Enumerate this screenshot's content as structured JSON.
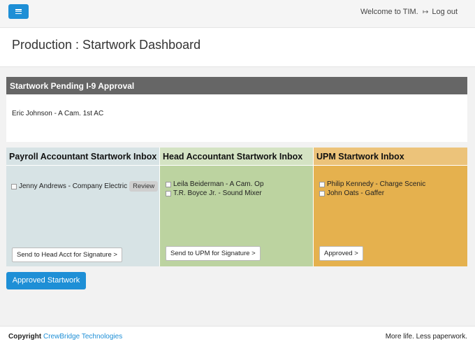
{
  "topbar": {
    "welcome": "Welcome to TIM.",
    "logout": "Log out",
    "menu_icon": "hamburger-icon",
    "logout_icon": "logout-icon"
  },
  "header": {
    "title": "Production : Startwork Dashboard"
  },
  "pending": {
    "title": "Startwork Pending I-9 Approval",
    "items": [
      "Eric Johnson - A Cam. 1st AC"
    ]
  },
  "inboxes": {
    "payroll": {
      "title": "Payroll Accountant Startwork Inbox",
      "items": [
        "Jenny Andrews - Company Electric"
      ],
      "review_label": "Review",
      "action": "Send to Head Acct for Signature >"
    },
    "head": {
      "title": "Head Accountant Startwork Inbox",
      "items": [
        "Leila Beiderman - A Cam. Op",
        "T.R. Boyce Jr. - Sound Mixer"
      ],
      "action": "Send to UPM for Signature >"
    },
    "upm": {
      "title": "UPM Startwork Inbox",
      "items": [
        "Philip Kennedy - Charge Scenic",
        "John Oats - Gaffer"
      ],
      "action": "Approved >"
    }
  },
  "approved_button": "Approved Startwork",
  "footer": {
    "copyright_label": "Copyright",
    "company": "CrewBridge Technologies",
    "tagline": "More life. Less paperwork."
  },
  "colors": {
    "accent": "#1e8fd6",
    "pending_header": "#666666",
    "payroll": "#d7e3e5",
    "head": "#bcd3a0",
    "upm": "#e5b14e"
  }
}
